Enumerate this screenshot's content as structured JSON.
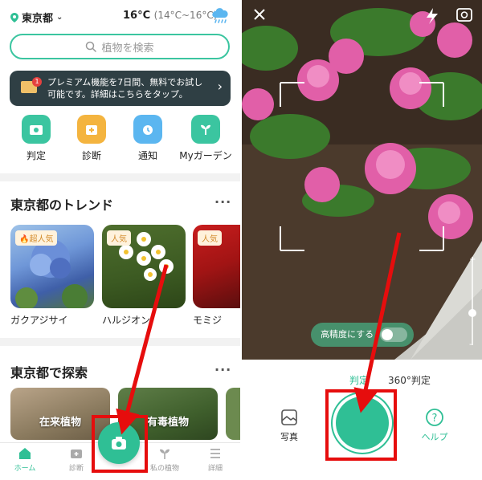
{
  "left": {
    "status": {
      "location": "東京都",
      "temperature": "16°C",
      "range": "(14°C~16°C)"
    },
    "search": {
      "placeholder": "植物を検索"
    },
    "banner": {
      "badge_count": "1",
      "text_line1": "プレミアム機能を7日間、無料でお試し",
      "text_line2": "可能です。詳細はこちらをタップ。"
    },
    "quick_actions": [
      {
        "label": "判定",
        "icon": "camera-icon",
        "color": "#3bc5a0"
      },
      {
        "label": "診断",
        "icon": "medkit-icon",
        "color": "#f4b43f"
      },
      {
        "label": "通知",
        "icon": "alarm-icon",
        "color": "#5bb6f0"
      },
      {
        "label": "Myガーデン",
        "icon": "sprout-icon",
        "color": "#3bc5a0"
      }
    ],
    "trends": {
      "title": "東京都のトレンド",
      "more": "···",
      "items": [
        {
          "tag": "🔥超人気",
          "label": "ガクアジサイ"
        },
        {
          "tag": "人気",
          "label": "ハルジオン"
        },
        {
          "tag": "人気",
          "label": "モミジ"
        }
      ]
    },
    "explore": {
      "title": "東京都で探索",
      "more": "···",
      "items": [
        {
          "label": "在来植物"
        },
        {
          "label": "有毒植物"
        }
      ]
    },
    "tabbar": [
      {
        "label": "ホーム",
        "active": true
      },
      {
        "label": "診断",
        "active": false
      },
      {
        "label": "私の植物",
        "active": false
      },
      {
        "label": "詳細",
        "active": false
      }
    ]
  },
  "right": {
    "high_precision_label": "高精度にする",
    "modes": {
      "identify": "判定",
      "spin": "360°判定"
    },
    "photo_label": "写真",
    "help_label": "ヘルプ"
  },
  "colors": {
    "accent": "#2fbf95",
    "annotation_red": "#e60d0d",
    "banner_bg": "#2f3f44"
  }
}
